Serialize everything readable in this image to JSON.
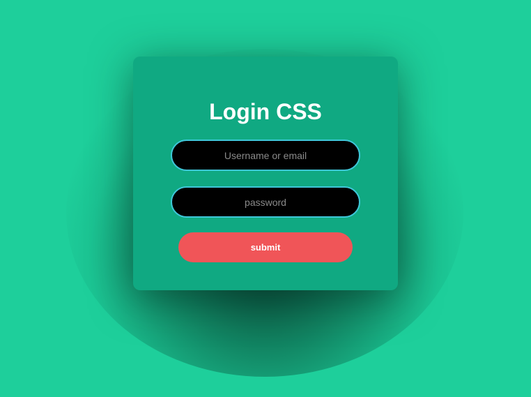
{
  "login_form": {
    "title": "Login CSS",
    "username_placeholder": "Username or email",
    "password_placeholder": "password",
    "submit_label": "submit"
  },
  "colors": {
    "background": "#1ecf9b",
    "card": "#10a982",
    "input_background": "#000000",
    "input_border": "#3ec7d8",
    "submit_button": "#f05558",
    "title_text": "#ffffff"
  }
}
